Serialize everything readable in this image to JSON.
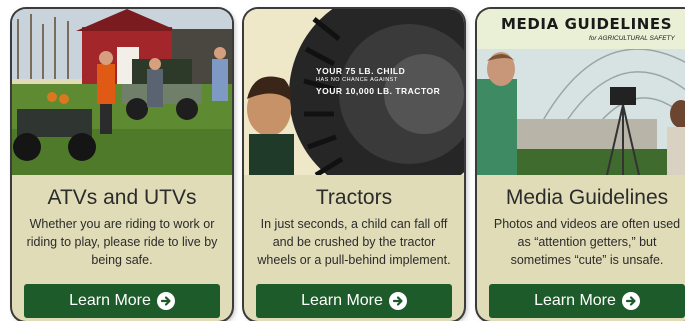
{
  "cards": [
    {
      "title": "ATVs and UTVs",
      "description": "Whether you are riding to work or riding to play, please ride to live by being safe.",
      "button_label": "Learn More"
    },
    {
      "title": "Tractors",
      "description": "In just seconds, a child can fall off and be crushed by the tractor wheels or a pull-behind implement.",
      "button_label": "Learn More",
      "image_text": {
        "line1": "YOUR 75 LB. CHILD",
        "line2": "HAS NO CHANCE AGAINST",
        "line3": "YOUR 10,000 LB. TRACTOR"
      }
    },
    {
      "title": "Media Guidelines",
      "description": "Photos and videos are often used as “attention getters,” but sometimes “cute” is unsafe.",
      "button_label": "Learn More",
      "image_text": {
        "banner_title": "MEDIA GUIDELINES",
        "banner_subtitle": "for AGRICULTURAL SAFETY"
      }
    }
  ],
  "colors": {
    "card_background": "#e0dcb8",
    "button_background": "#1d5b2a",
    "text": "#2b2b2b"
  }
}
